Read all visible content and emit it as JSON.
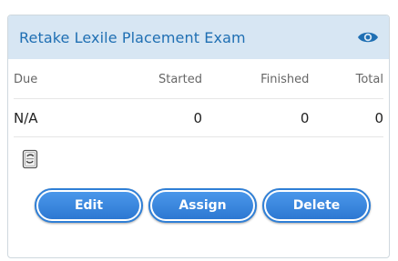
{
  "card": {
    "title": "Retake Lexile Placement Exam",
    "header_icon": "eye-icon",
    "accent_color": "#1f6fb3",
    "header_bg": "#d7e6f3"
  },
  "stats": {
    "headers": [
      "Due",
      "Started",
      "Finished",
      "Total"
    ],
    "values": [
      "N/A",
      "0",
      "0",
      "0"
    ]
  },
  "document_icon": "lexile-document-icon",
  "buttons": {
    "edit": "Edit",
    "assign": "Assign",
    "delete": "Delete",
    "color": "#3a88e0"
  }
}
